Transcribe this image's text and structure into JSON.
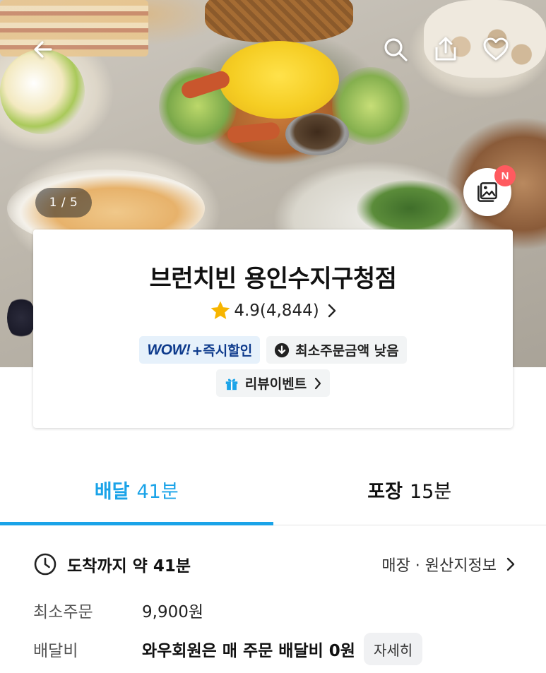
{
  "hero": {
    "image_counter": "1 / 5",
    "photo_badge": "N",
    "icons": {
      "back": "arrow-left-icon",
      "search": "search-icon",
      "share": "share-icon",
      "favorite": "heart-icon",
      "photos": "photo-gallery-icon"
    }
  },
  "store": {
    "name": "브런치빈 용인수지구청점",
    "rating": "4.9",
    "review_count": "(4,844)",
    "tags": {
      "wow_logo": "WOW!",
      "wow_text": "+즉시할인",
      "min_order_tag": "최소주문금액 낮음",
      "review_event": "리뷰이벤트"
    }
  },
  "tabs": [
    {
      "label": "배달",
      "time": "41분",
      "active": true
    },
    {
      "label": "포장",
      "time": "15분",
      "active": false
    }
  ],
  "info": {
    "eta": "도착까지 약 41분",
    "origin_link": "매장 · 원산지정보",
    "min_order_label": "최소주문",
    "min_order_value": "9,900원",
    "delivery_fee_label": "배달비",
    "delivery_fee_value": "와우회원은 매 주문 배달비 0원",
    "detail_button": "자세히"
  },
  "colors": {
    "accent": "#1aa3e8",
    "wow_navy": "#0d3a8c",
    "badge_red": "#ff5a5f",
    "star": "#f7b500"
  }
}
